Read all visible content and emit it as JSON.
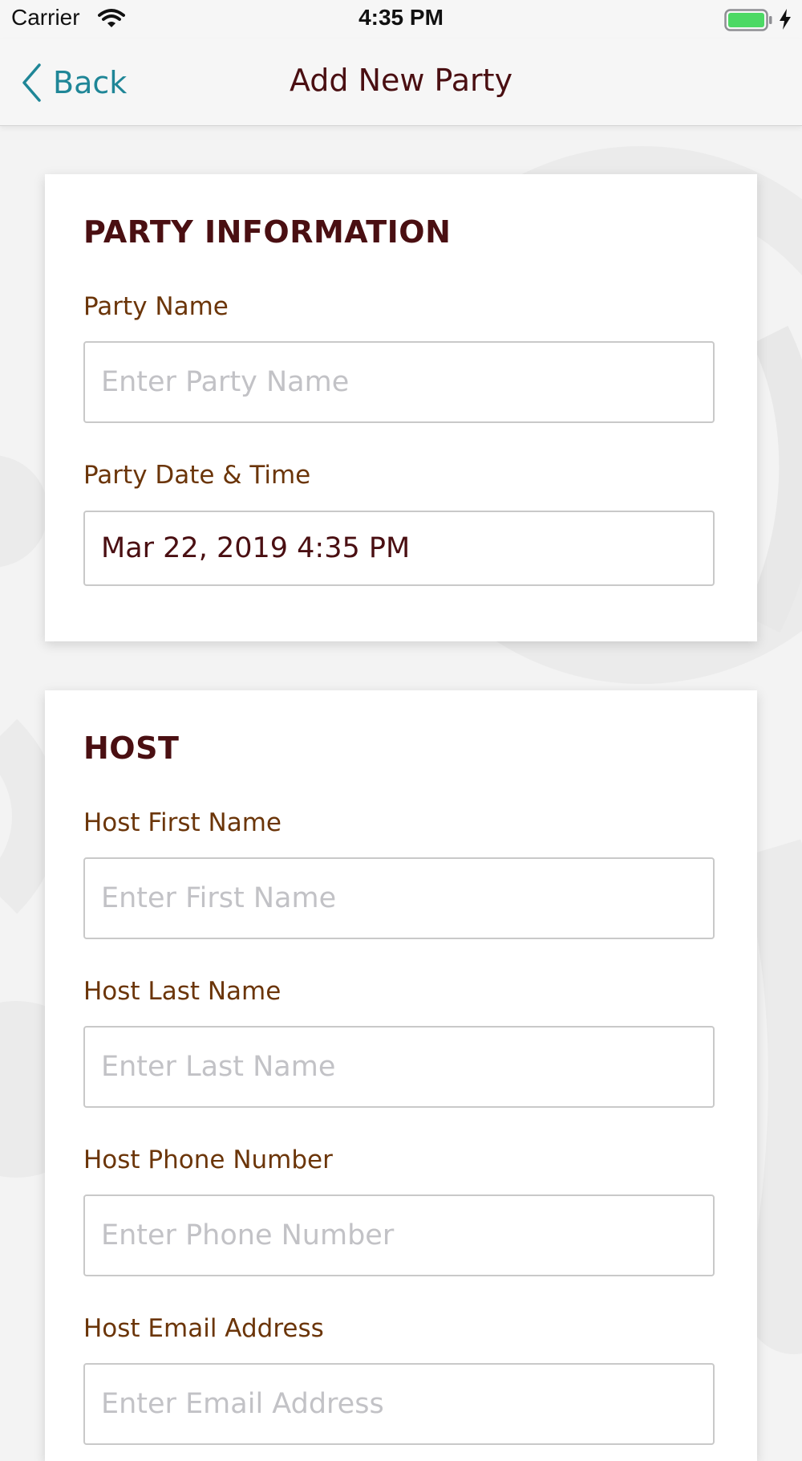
{
  "status_bar": {
    "carrier": "Carrier",
    "time": "4:35 PM",
    "icons": [
      "wifi-icon",
      "battery-icon",
      "charging-bolt-icon"
    ],
    "battery_color": "#4cd964"
  },
  "nav": {
    "back_label": "Back",
    "back_icon": "chevron-left-icon",
    "title": "Add New Party"
  },
  "party_info": {
    "heading": "PARTY INFORMATION",
    "name_label": "Party Name",
    "name_placeholder": "Enter Party Name",
    "name_value": "",
    "datetime_label": "Party Date & Time",
    "datetime_value": "Mar 22, 2019 4:35 PM"
  },
  "host": {
    "heading": "HOST",
    "first_name_label": "Host First Name",
    "first_name_placeholder": "Enter First Name",
    "last_name_label": "Host Last Name",
    "last_name_placeholder": "Enter Last Name",
    "phone_label": "Host Phone Number",
    "phone_placeholder": "Enter Phone Number",
    "email_label": "Host Email Address",
    "email_placeholder": "Enter Email Address"
  },
  "colors": {
    "accent": "#1f8697",
    "heading": "#4a0f12",
    "label": "#6b3509",
    "placeholder": "#c2c2c6",
    "background": "#f3f3f3"
  }
}
